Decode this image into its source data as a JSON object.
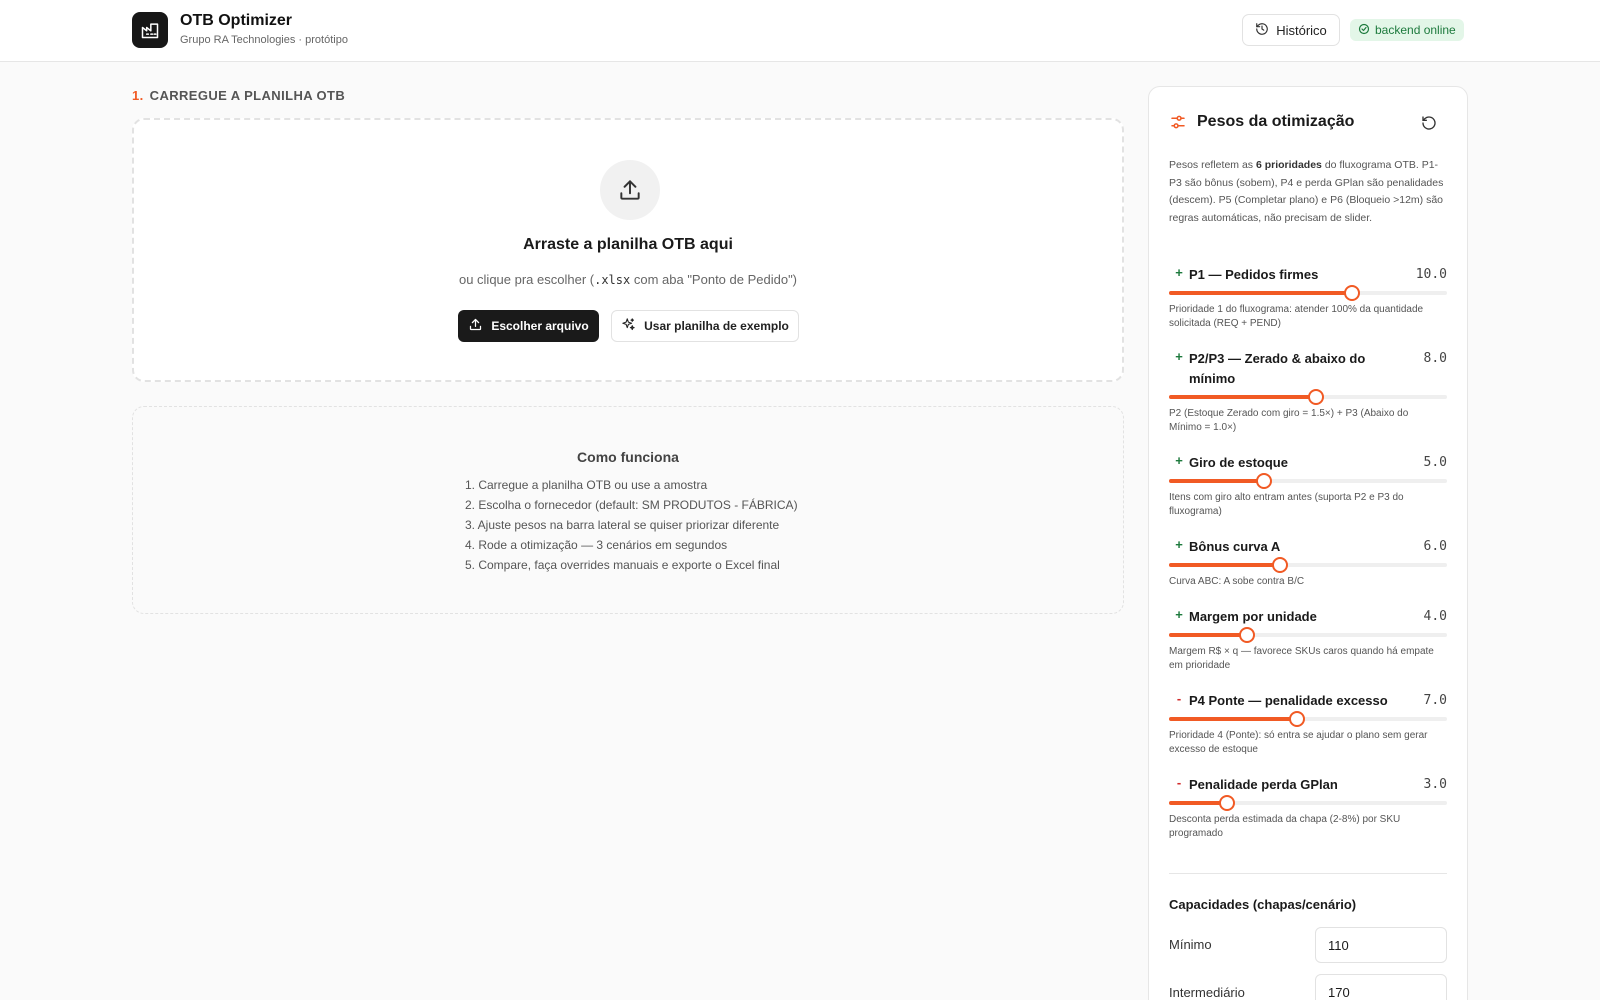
{
  "header": {
    "app_title": "OTB Optimizer",
    "app_subtitle": "Grupo RA Technologies · protótipo",
    "history_label": "Histórico",
    "status_label": "backend online"
  },
  "upload": {
    "step_number": "1.",
    "step_title": "CARREGUE A PLANILHA OTB",
    "drop_title": "Arraste a planilha OTB aqui",
    "drop_sub_prefix": "ou clique pra escolher (",
    "drop_sub_code": ".xlsx",
    "drop_sub_suffix": " com aba \"Ponto de Pedido\")",
    "choose_file_label": "Escolher arquivo",
    "sample_label": "Usar planilha de exemplo"
  },
  "howto": {
    "title": "Como funciona",
    "steps": [
      "1. Carregue a planilha OTB ou use a amostra",
      "2. Escolha o fornecedor (default: SM PRODUTOS - FÁBRICA)",
      "3. Ajuste pesos na barra lateral se quiser priorizar diferente",
      "4. Rode a otimização — 3 cenários em segundos",
      "5. Compare, faça overrides manuais e exporte o Excel final"
    ]
  },
  "sidebar": {
    "title": "Pesos da otimização",
    "desc_1": "Pesos refletem as ",
    "desc_bold": "6 prioridades",
    "desc_2": " do fluxograma OTB. P1-P3 são bônus (sobem), P4 e perda GPlan são penalidades (descem). P5 (Completar plano) e P6 (Bloqueio >12m) são regras automáticas, não precisam de slider.",
    "weights": [
      {
        "sign": "+",
        "label": "P1 — Pedidos firmes",
        "value": "10.0",
        "fraction": 0.66,
        "desc": "Prioridade 1 do fluxograma: atender 100% da quantidade solicitada (REQ + PEND)"
      },
      {
        "sign": "+",
        "label": "P2/P3 — Zerado & abaixo do mínimo",
        "value": "8.0",
        "fraction": 0.53,
        "desc": "P2 (Estoque Zerado com giro = 1.5×) + P3 (Abaixo do Mínimo = 1.0×)"
      },
      {
        "sign": "+",
        "label": "Giro de estoque",
        "value": "5.0",
        "fraction": 0.34,
        "desc": "Itens com giro alto entram antes (suporta P2 e P3 do fluxograma)"
      },
      {
        "sign": "+",
        "label": "Bônus curva A",
        "value": "6.0",
        "fraction": 0.4,
        "desc": "Curva ABC: A sobe contra B/C"
      },
      {
        "sign": "+",
        "label": "Margem por unidade",
        "value": "4.0",
        "fraction": 0.28,
        "desc": "Margem R$ × q — favorece SKUs caros quando há empate em prioridade"
      },
      {
        "sign": "-",
        "label": "P4 Ponte — penalidade excesso",
        "value": "7.0",
        "fraction": 0.46,
        "desc": "Prioridade 4 (Ponte): só entra se ajudar o plano sem gerar excesso de estoque"
      },
      {
        "sign": "-",
        "label": "Penalidade perda GPlan",
        "value": "3.0",
        "fraction": 0.21,
        "desc": "Desconta perda estimada da chapa (2-8%) por SKU programado"
      }
    ],
    "capacities_title": "Capacidades (chapas/cenário)",
    "capacities": [
      {
        "label": "Mínimo",
        "value": "110"
      },
      {
        "label": "Intermediário",
        "value": "170"
      }
    ]
  },
  "colors": {
    "accent": "#f15a24",
    "online": "#1d7a3d",
    "online_bg": "#e3f6e8"
  }
}
